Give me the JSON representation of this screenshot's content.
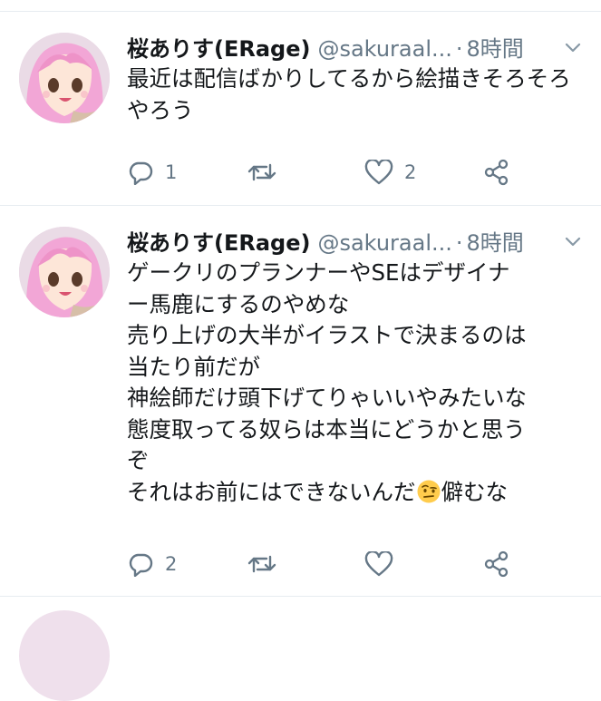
{
  "tweets": [
    {
      "name": "桜ありす(ERage)",
      "handle": "@sakuraal...",
      "separator": "·",
      "time": "8時間",
      "text": "最近は配信ばかりしてるから絵描きそろそろやろう",
      "replies": "1",
      "retweets": "",
      "likes": "2"
    },
    {
      "name": "桜ありす(ERage)",
      "handle": "@sakuraal...",
      "separator": "·",
      "time": "8時間",
      "text_lines": [
        "ゲークリのプランナーやSEはデザイナ",
        "ー馬鹿にするのやめな",
        "売り上げの大半がイラストで決まるのは",
        "当たり前だが",
        "神絵師だけ頭下げてりゃいいやみたいな",
        "態度取ってる奴らは本当にどうかと思う",
        "ぞ",
        "それはお前にはできないんだ",
        "僻むな"
      ],
      "emoji": "face-with-raised-eyebrow",
      "replies": "2",
      "retweets": "",
      "likes": ""
    }
  ],
  "colors": {
    "text": "#14171a",
    "secondary": "#657786",
    "divider": "#e6ecf0",
    "avatar_hair": "#f2a6d6"
  },
  "icons": [
    "reply-icon",
    "retweet-icon",
    "like-icon",
    "share-icon",
    "caret-down-icon"
  ]
}
